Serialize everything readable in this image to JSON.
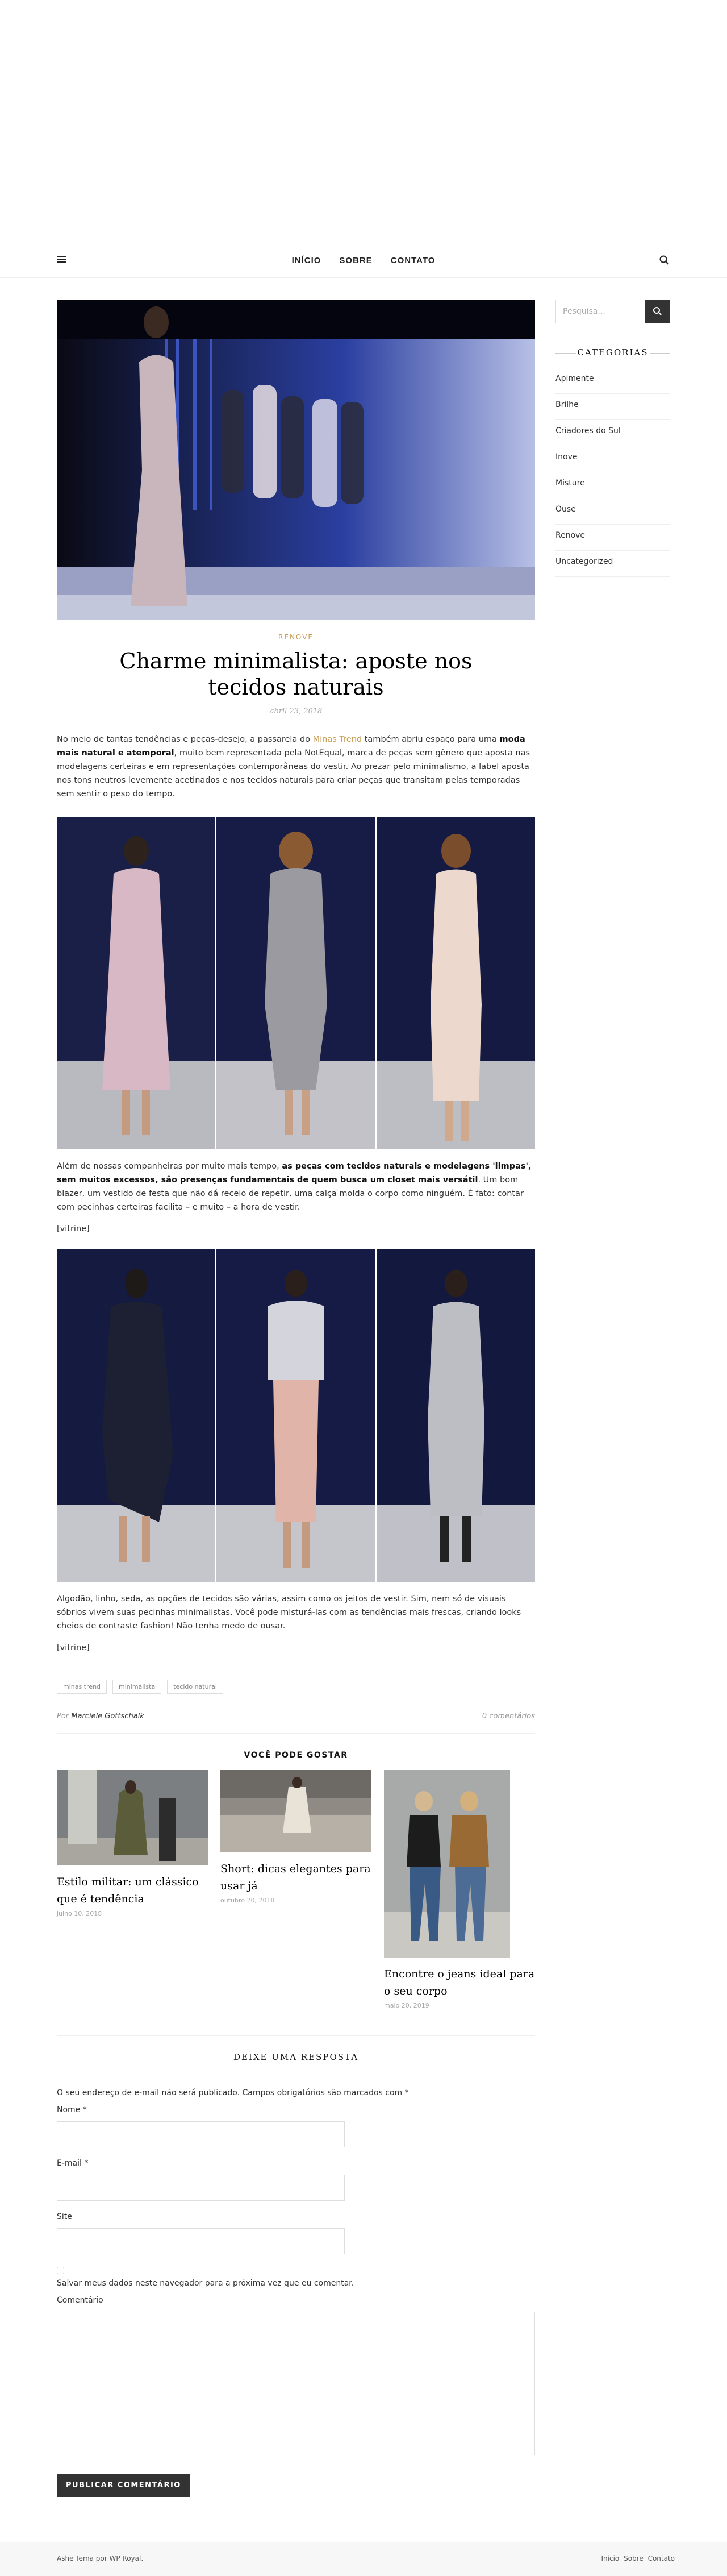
{
  "nav": {
    "items": [
      "INÍCIO",
      "SOBRE",
      "CONTATO"
    ]
  },
  "post": {
    "category": "RENOVE",
    "title": "Charme minimalista: aposte nos tecidos naturais",
    "date": "abril 23, 2018",
    "p1_a": "No meio de tantas tendências e peças-desejo, a passarela do ",
    "p1_link": "Minas Trend",
    "p1_b": " também abriu espaço para uma ",
    "p1_bold": "moda mais natural e atemporal",
    "p1_c": ", muito bem representada pela NotEqual, marca de peças sem gênero que aposta nas modelagens certeiras e em representações contemporâneas do vestir. Ao prezar pelo minimalismo, a label aposta nos tons neutros levemente acetinados e nos tecidos naturais para criar peças que transitam pelas temporadas sem sentir o peso do tempo.",
    "p2_a": "Além de nossas companheiras por muito mais tempo, ",
    "p2_bold": "as peças com tecidos naturais e modelagens 'limpas', sem muitos excessos, são presenças fundamentais de quem busca um closet mais versátil",
    "p2_b": ". Um bom blazer, um vestido de festa que não dá receio de repetir, uma calça molda o corpo como ninguém. É fato: contar com pecinhas certeiras facilita – e muito – a hora de vestir.",
    "vitrine1": "[vitrine]",
    "p3": "Algodão, linho, seda, as opções de tecidos são várias, assim como os jeitos de vestir. Sim, nem só de visuais sóbrios vivem suas pecinhas minimalistas. Você pode misturá-las com as tendências mais frescas, criando looks cheios de contraste fashion! Não tenha medo de ousar.",
    "vitrine2": "[vitrine]",
    "tags": [
      "minas trend",
      "minimalista",
      "tecido natural"
    ],
    "by": "Por",
    "author": "Marciele Gottschalk",
    "comments": "0 comentários"
  },
  "related": {
    "title": "VOCÊ PODE GOSTAR",
    "items": [
      {
        "title": "Estilo militar: um clássico que é tendência",
        "date": "julho 10, 2018"
      },
      {
        "title": "Short: dicas elegantes para usar já",
        "date": "outubro 20, 2018"
      },
      {
        "title": "Encontre o jeans ideal para o seu corpo",
        "date": "maio 20, 2019"
      }
    ]
  },
  "comment_form": {
    "title": "DEIXE UMA RESPOSTA",
    "note": "O seu endereço de e-mail não será publicado. Campos obrigatórios são marcados com *",
    "name_label": "Nome *",
    "email_label": "E-mail *",
    "site_label": "Site",
    "save_label": "Salvar meus dados neste navegador para a próxima vez que eu comentar.",
    "comment_label": "Comentário",
    "submit": "PUBLICAR COMENTÁRIO"
  },
  "sidebar": {
    "search_placeholder": "Pesquisa...",
    "categories_title": "CATEGORIAS",
    "categories": [
      "Apimente",
      "Brilhe",
      "Criadores do Sul",
      "Inove",
      "Misture",
      "Ouse",
      "Renove",
      "Uncategorized"
    ]
  },
  "footer": {
    "credit": "Ashe Tema por WP Royal.",
    "links": [
      "Início",
      "Sobre",
      "Contato"
    ]
  },
  "colors": {
    "accent": "#ca9b52",
    "button": "#333333"
  }
}
